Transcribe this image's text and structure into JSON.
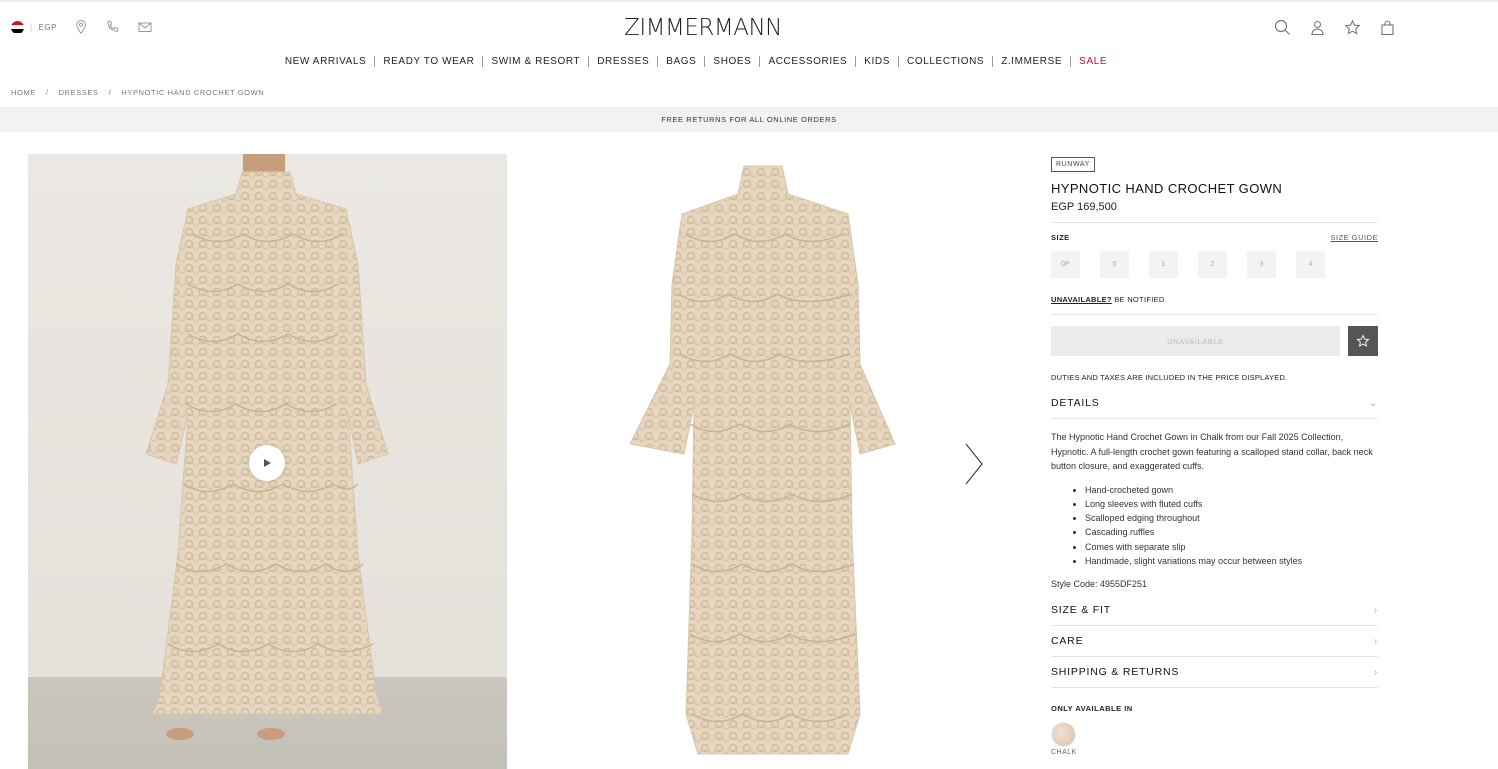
{
  "header": {
    "currency": "EGP",
    "separator": "|",
    "logo": "ZIMMERMANN",
    "flag_colors": [
      "#ce1126",
      "#ffffff",
      "#000000"
    ]
  },
  "nav": {
    "items": [
      "NEW ARRIVALS",
      "READY TO WEAR",
      "SWIM & RESORT",
      "DRESSES",
      "BAGS",
      "SHOES",
      "ACCESSORIES",
      "KIDS",
      "COLLECTIONS",
      "Z.IMMERSE",
      "SALE"
    ],
    "sale_color": "#c8102e"
  },
  "breadcrumb": {
    "home": "HOME",
    "sep": "/",
    "category": "DRESSES",
    "current": "HYPNOTIC HAND CROCHET GOWN"
  },
  "banner": {
    "text": "FREE RETURNS FOR ALL ONLINE ORDERS"
  },
  "product": {
    "badge": "RUNWAY",
    "title": "HYPNOTIC HAND CROCHET GOWN",
    "price": "EGP 169,500",
    "size_label": "SIZE",
    "size_guide": "SIZE GUIDE",
    "sizes": [
      "0P",
      "0",
      "1",
      "2",
      "3",
      "4"
    ],
    "unavailable_link": "UNAVAILABLE?",
    "be_notified": "BE NOTIFIED",
    "add_button": "UNAVAILABLE",
    "duties": "DUTIES AND TAXES ARE INCLUDED IN THE PRICE DISPLAYED.",
    "details_label": "DETAILS",
    "description": "The Hypnotic Hand Crochet Gown in Chalk from our Fall 2025 Collection, Hypnotic. A full-length crochet gown featuring a scalloped stand collar, back neck button closure, and exaggerated cuffs.",
    "bullets": [
      "Hand-crocheted gown",
      "Long sleeves with fluted cuffs",
      "Scalloped edging throughout",
      "Cascading ruffles",
      "Comes with separate slip",
      "Handmade, slight variations may occur between styles"
    ],
    "style_code": "Style Code: 4955DF251",
    "size_fit": "SIZE & FIT",
    "care": "CARE",
    "shipping": "SHIPPING & RETURNS",
    "only_available": "ONLY AVAILABLE IN",
    "color_name": "CHALK"
  },
  "icons": {
    "location": "location-pin-icon",
    "phone": "phone-icon",
    "mail": "mail-icon",
    "search": "search-icon",
    "account": "account-icon",
    "wishlist": "star-icon",
    "bag": "bag-icon",
    "play": "play-icon",
    "next": "chevron-right-icon"
  }
}
